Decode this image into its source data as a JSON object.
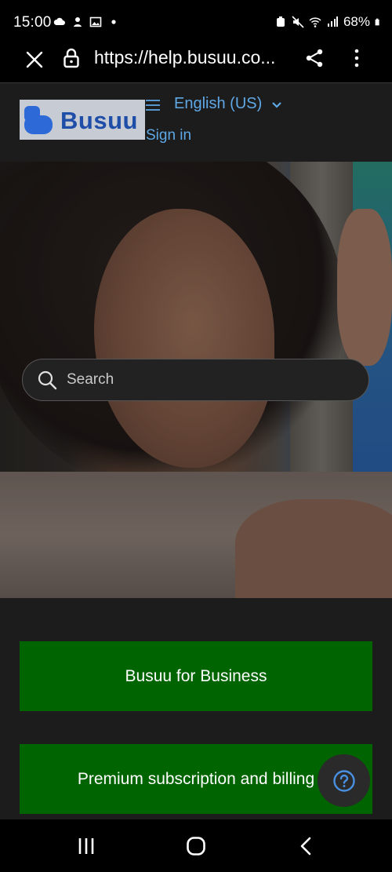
{
  "status_bar": {
    "time": "15:00",
    "battery": "68%",
    "left_icons": [
      "cloud-icon",
      "app-notification-icon",
      "image-icon",
      "dot-icon"
    ],
    "right_icons": [
      "alarm-icon",
      "mute-icon",
      "wifi-icon",
      "signal-icon",
      "battery-icon"
    ]
  },
  "browser": {
    "url": "https://help.busuu.co..."
  },
  "header": {
    "logo_text": "Busuu",
    "language": "English (US)",
    "sign_in": "Sign in"
  },
  "search": {
    "placeholder": "Search"
  },
  "cards": [
    {
      "label": "Busuu for Business"
    },
    {
      "label": "Premium subscription and billing"
    }
  ],
  "colors": {
    "card_bg": "#006400",
    "link": "#5fa8e6",
    "brand_blue": "#1f4ea8",
    "help_icon": "#4a90e2"
  }
}
